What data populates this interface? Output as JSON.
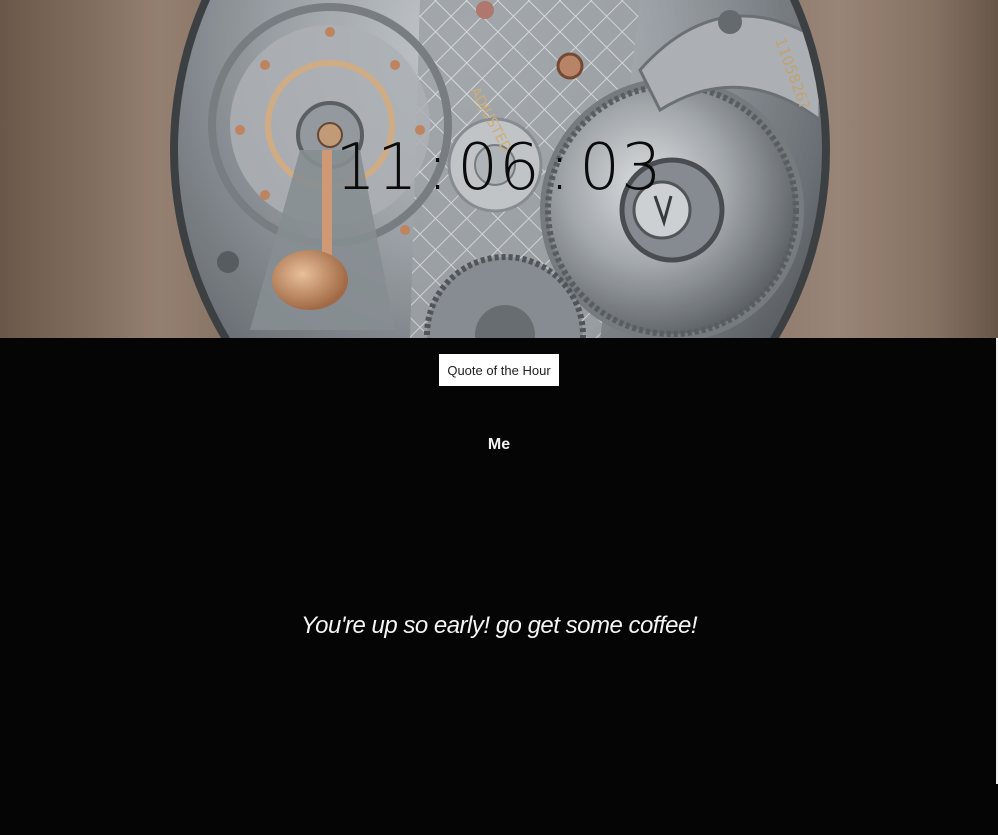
{
  "clock": {
    "hours": "11",
    "minutes": "06",
    "seconds": "03",
    "separator": ":"
  },
  "quote_button": {
    "label": "Quote of the Hour"
  },
  "quote": {
    "author": "Me",
    "text": "You're up so early! go get some coffee!"
  },
  "hero_image": {
    "subject": "pocket watch movement",
    "engravings": [
      "ADJUSTED",
      "1105826?"
    ]
  },
  "colors": {
    "page_background": "#050505",
    "clock_text": "#0b0b0b",
    "button_background": "#ffffff",
    "quote_text": "#f4f4f4"
  }
}
